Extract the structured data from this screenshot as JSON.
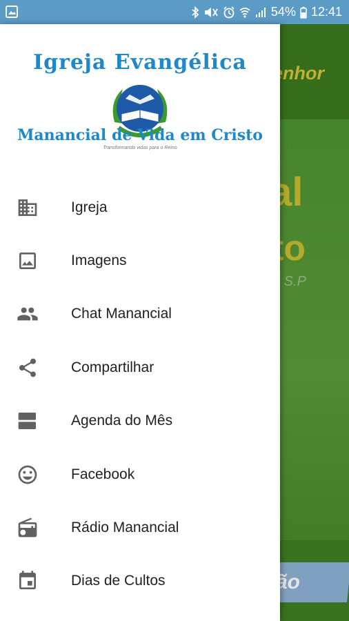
{
  "status_bar": {
    "battery": "54%",
    "time": "12:41"
  },
  "background_app": {
    "toolbar_title_fragment": "enhor",
    "main_line1_fragment": "ial",
    "main_line2_fragment": "sto",
    "main_line3_fragment": "é S.P",
    "banner_fragment": "ão"
  },
  "drawer": {
    "header": {
      "title_top": "Igreja Evangélica",
      "title_bottom": "Manancial de Vida em Cristo",
      "tagline": "Transformando vidas para o Reino"
    },
    "items": [
      {
        "label": "Igreja",
        "icon": "business-icon"
      },
      {
        "label": "Imagens",
        "icon": "photo-frame-icon"
      },
      {
        "label": "Chat Manancial",
        "icon": "people-icon"
      },
      {
        "label": "Compartilhar",
        "icon": "share-icon"
      },
      {
        "label": "Agenda do Mês",
        "icon": "view-agenda-icon"
      },
      {
        "label": "Facebook",
        "icon": "smiley-icon"
      },
      {
        "label": "Rádio Manancial",
        "icon": "radio-icon"
      },
      {
        "label": "Dias de Cultos",
        "icon": "calendar-icon"
      }
    ]
  },
  "colors": {
    "status_bar": "#5b9bc6",
    "app_green": "#4d8f2f",
    "logo_blue": "#1e88c9",
    "icon_gray": "#616161"
  }
}
